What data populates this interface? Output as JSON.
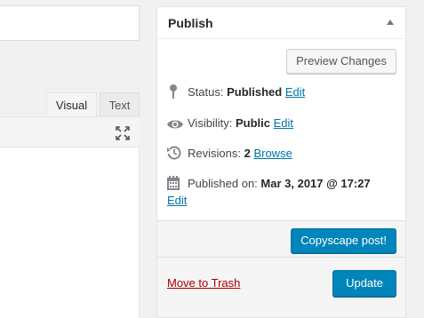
{
  "editor": {
    "tabs": [
      {
        "label": "Visual"
      },
      {
        "label": "Text"
      }
    ]
  },
  "publish": {
    "title": "Publish",
    "preview_label": "Preview Changes",
    "status": {
      "label": "Status:",
      "value": "Published",
      "edit": "Edit"
    },
    "visibility": {
      "label": "Visibility:",
      "value": "Public",
      "edit": "Edit"
    },
    "revisions": {
      "label": "Revisions:",
      "value": "2",
      "link": "Browse"
    },
    "published_on": {
      "label": "Published on:",
      "value": "Mar 3, 2017 @ 17:27",
      "edit": "Edit"
    },
    "copyscape_label": "Copyscape post!",
    "trash_label": "Move to Trash",
    "update_label": "Update"
  },
  "icons": {
    "status": "pin-icon",
    "visibility": "eye-icon",
    "revisions": "history-icon",
    "published_on": "calendar-icon",
    "fullscreen": "fullscreen-icon",
    "toggle": "arrow-up-icon"
  },
  "colors": {
    "primary_button": "#0085ba",
    "link": "#0073aa",
    "trash": "#aa0000",
    "background": "#f1f1f1"
  }
}
